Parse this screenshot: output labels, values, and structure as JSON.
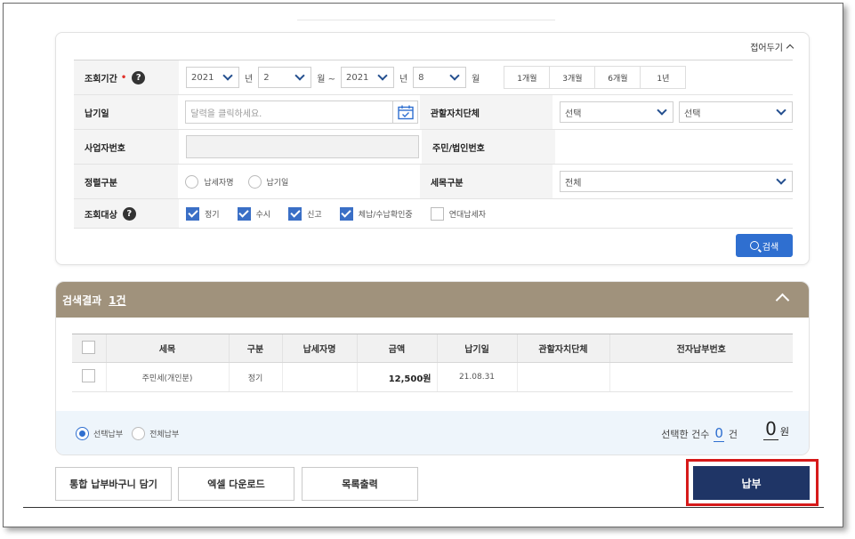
{
  "search": {
    "collapse_label": "접어두기",
    "period": {
      "label": "조회기간",
      "required_mark": "•",
      "help": "?",
      "start_year": "2021",
      "year_unit": "년",
      "start_month": "2",
      "month_unit_tilde": "월 ~",
      "end_year": "2021",
      "end_month": "8",
      "month_unit": "월",
      "quick_buttons": [
        "1개월",
        "3개월",
        "6개월",
        "1년"
      ]
    },
    "due_date": {
      "label": "납기일",
      "placeholder": "달력을 클릭하세요."
    },
    "jurisdiction": {
      "label": "관할자치단체",
      "select1": "선택",
      "select2": "선택"
    },
    "business_no": {
      "label": "사업자번호"
    },
    "resident_no": {
      "label": "주민/법인번호"
    },
    "sort": {
      "label": "정렬구분",
      "options": [
        "납세자명",
        "납기일"
      ]
    },
    "tax_type": {
      "label": "세목구분",
      "value": "전체"
    },
    "target": {
      "label": "조회대상",
      "help": "?",
      "options": [
        "정기",
        "수시",
        "신고",
        "체납/수납확인중",
        "연대납세자"
      ]
    },
    "search_button": "검색"
  },
  "results": {
    "title": "검색결과",
    "count": "1건",
    "columns": [
      "세목",
      "구분",
      "납세자명",
      "금액",
      "납기일",
      "관할자치단체",
      "전자납부번호"
    ],
    "rows": [
      {
        "tax": "주민세(개인분)",
        "type": "정기",
        "taxpayer": "",
        "amount": "12,500원",
        "due": "21.08.31",
        "jurisdiction": "",
        "epay_no": ""
      }
    ],
    "pay_mode": [
      "선택납부",
      "전체납부"
    ],
    "selected_count_label": "선택한 건수",
    "selected_count": "0",
    "count_unit": "건",
    "total_amount": "0",
    "currency_unit": "원"
  },
  "actions": {
    "cart": "통합 납부바구니 담기",
    "excel": "엑셀 다운로드",
    "print": "목록출력",
    "pay": "납부"
  },
  "colors": {
    "primary_blue": "#2f6fd0",
    "header_brown": "#a0927c",
    "pay_navy": "#1f3566",
    "highlight_red": "#d61a1a"
  }
}
